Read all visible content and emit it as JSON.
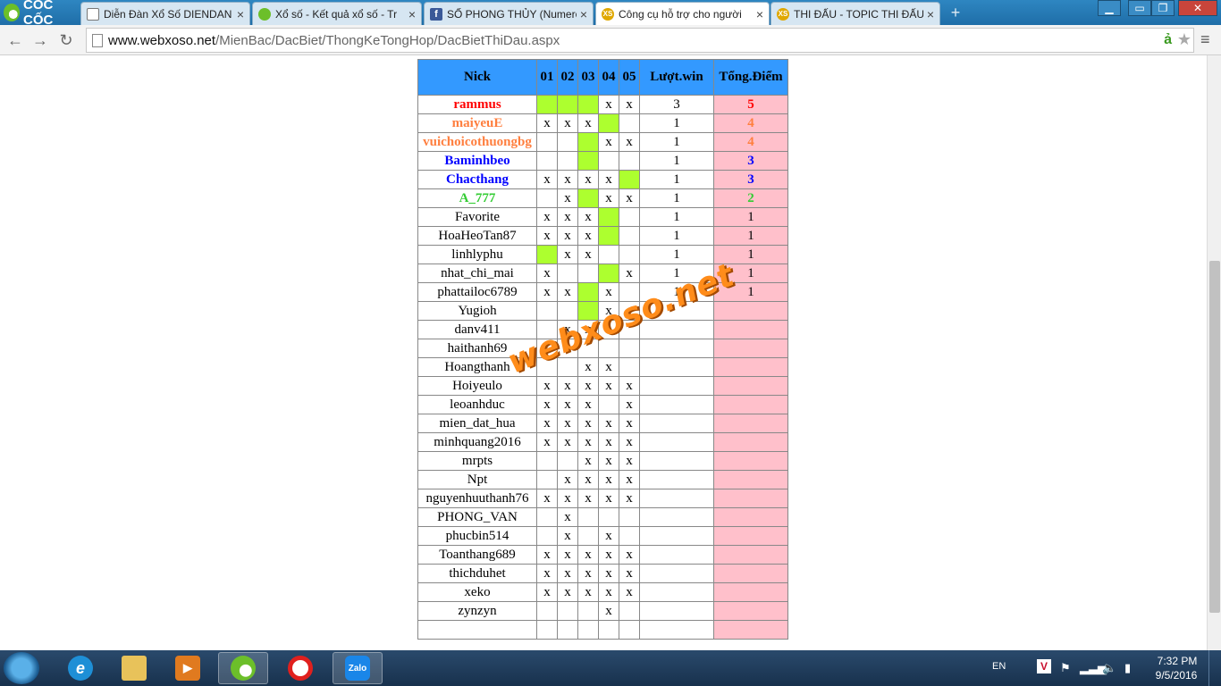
{
  "browser": {
    "brand": "CỐC CỐC",
    "tabs": [
      {
        "label": "Diễn Đàn Xổ Số DIENDAN",
        "icon": "page-icon",
        "active": false
      },
      {
        "label": "Xổ số - Kết quả xổ số - Tr",
        "icon": "coccoc-icon",
        "active": false
      },
      {
        "label": "SỐ PHONG THỦY (Numero",
        "icon": "facebook-icon",
        "active": false
      },
      {
        "label": "Công cụ hỗ trợ cho người",
        "icon": "xs-icon",
        "active": true
      },
      {
        "label": "THI ĐẤU - TOPIC THI ĐẤU",
        "icon": "xs-icon",
        "active": false
      }
    ],
    "xs_badge": "XS",
    "address": {
      "host": "www.webxoso.net",
      "path": "/MienBac/DacBiet/ThongKeTongHop/DacBietThiDau.aspx"
    },
    "translate_glyph": "ả"
  },
  "table": {
    "headers": {
      "nick": "Nick",
      "m1": "01",
      "m2": "02",
      "m3": "03",
      "m4": "04",
      "m5": "05",
      "wins": "Lượt.win",
      "points": "Tổng.Điểm"
    },
    "rows": [
      {
        "nick": "rammus",
        "color": "red",
        "marks": [
          "hit",
          "hit",
          "hit",
          "x",
          "x"
        ],
        "wins": "3",
        "points": "5"
      },
      {
        "nick": "maiyeuE",
        "color": "orange",
        "marks": [
          "x",
          "x",
          "x",
          "hit",
          ""
        ],
        "wins": "1",
        "points": "4"
      },
      {
        "nick": "vuichoicothuongbg",
        "color": "orange",
        "marks": [
          "",
          "",
          "hit",
          "x",
          "x"
        ],
        "wins": "1",
        "points": "4"
      },
      {
        "nick": "Baminhbeo",
        "color": "blue",
        "marks": [
          "",
          "",
          "hit",
          "",
          ""
        ],
        "wins": "1",
        "points": "3"
      },
      {
        "nick": "Chacthang",
        "color": "blue",
        "marks": [
          "x",
          "x",
          "x",
          "x",
          "hit"
        ],
        "wins": "1",
        "points": "3"
      },
      {
        "nick": "A_777",
        "color": "green",
        "marks": [
          "",
          "x",
          "hit",
          "x",
          "x"
        ],
        "wins": "1",
        "points": "2"
      },
      {
        "nick": "Favorite",
        "color": "plain",
        "marks": [
          "x",
          "x",
          "x",
          "hit",
          ""
        ],
        "wins": "1",
        "points": "1"
      },
      {
        "nick": "HoaHeoTan87",
        "color": "plain",
        "marks": [
          "x",
          "x",
          "x",
          "hit",
          ""
        ],
        "wins": "1",
        "points": "1"
      },
      {
        "nick": "linhlyphu",
        "color": "plain",
        "marks": [
          "hit",
          "x",
          "x",
          "",
          ""
        ],
        "wins": "1",
        "points": "1"
      },
      {
        "nick": "nhat_chi_mai",
        "color": "plain",
        "marks": [
          "x",
          "",
          "",
          "hit",
          "x"
        ],
        "wins": "1",
        "points": "1"
      },
      {
        "nick": "phattailoc6789",
        "color": "plain",
        "marks": [
          "x",
          "x",
          "hit",
          "x",
          ""
        ],
        "wins": "1",
        "points": "1"
      },
      {
        "nick": "Yugioh",
        "color": "plain",
        "marks": [
          "",
          "",
          "hit",
          "x",
          ""
        ],
        "wins": "",
        "points": ""
      },
      {
        "nick": "danv411",
        "color": "plain",
        "marks": [
          "",
          "x",
          "x",
          "",
          ""
        ],
        "wins": "",
        "points": ""
      },
      {
        "nick": "haithanh69",
        "color": "plain",
        "marks": [
          "",
          "",
          "",
          "",
          ""
        ],
        "wins": "",
        "points": ""
      },
      {
        "nick": "Hoangthanh",
        "color": "plain",
        "marks": [
          "",
          "",
          "x",
          "x",
          ""
        ],
        "wins": "",
        "points": ""
      },
      {
        "nick": "Hoiyeulo",
        "color": "plain",
        "marks": [
          "x",
          "x",
          "x",
          "x",
          "x"
        ],
        "wins": "",
        "points": ""
      },
      {
        "nick": "leoanhduc",
        "color": "plain",
        "marks": [
          "x",
          "x",
          "x",
          "",
          "x"
        ],
        "wins": "",
        "points": ""
      },
      {
        "nick": "mien_dat_hua",
        "color": "plain",
        "marks": [
          "x",
          "x",
          "x",
          "x",
          "x"
        ],
        "wins": "",
        "points": ""
      },
      {
        "nick": "minhquang2016",
        "color": "plain",
        "marks": [
          "x",
          "x",
          "x",
          "x",
          "x"
        ],
        "wins": "",
        "points": ""
      },
      {
        "nick": "mrpts",
        "color": "plain",
        "marks": [
          "",
          "",
          "x",
          "x",
          "x"
        ],
        "wins": "",
        "points": ""
      },
      {
        "nick": "Npt",
        "color": "plain",
        "marks": [
          "",
          "x",
          "x",
          "x",
          "x"
        ],
        "wins": "",
        "points": ""
      },
      {
        "nick": "nguyenhuuthanh76",
        "color": "plain",
        "marks": [
          "x",
          "x",
          "x",
          "x",
          "x"
        ],
        "wins": "",
        "points": ""
      },
      {
        "nick": "PHONG_VAN",
        "color": "plain",
        "marks": [
          "",
          "x",
          "",
          "",
          ""
        ],
        "wins": "",
        "points": ""
      },
      {
        "nick": "phucbin514",
        "color": "plain",
        "marks": [
          "",
          "x",
          "",
          "x",
          ""
        ],
        "wins": "",
        "points": ""
      },
      {
        "nick": "Toanthang689",
        "color": "plain",
        "marks": [
          "x",
          "x",
          "x",
          "x",
          "x"
        ],
        "wins": "",
        "points": ""
      },
      {
        "nick": "thichduhet",
        "color": "plain",
        "marks": [
          "x",
          "x",
          "x",
          "x",
          "x"
        ],
        "wins": "",
        "points": ""
      },
      {
        "nick": "xeko",
        "color": "plain",
        "marks": [
          "x",
          "x",
          "x",
          "x",
          "x"
        ],
        "wins": "",
        "points": ""
      },
      {
        "nick": "zynzyn",
        "color": "plain",
        "marks": [
          "",
          "",
          "",
          "x",
          ""
        ],
        "wins": "",
        "points": ""
      },
      {
        "nick": "",
        "color": "plain",
        "marks": [
          "",
          "",
          "",
          "",
          ""
        ],
        "wins": "",
        "points": ""
      }
    ],
    "hit_color": "#adff2f",
    "header_color": "#3399ff",
    "points_bg": "#ffc0cb"
  },
  "watermark": "webxoso.net",
  "taskbar": {
    "apps": [
      "internet-explorer-icon",
      "file-explorer-icon",
      "media-player-icon",
      "coccoc-browser-icon",
      "opera-icon",
      "zalo-icon"
    ],
    "zalo_label": "Zalo",
    "language": "EN",
    "clock_time": "7:32 PM",
    "clock_date": "9/5/2016"
  }
}
